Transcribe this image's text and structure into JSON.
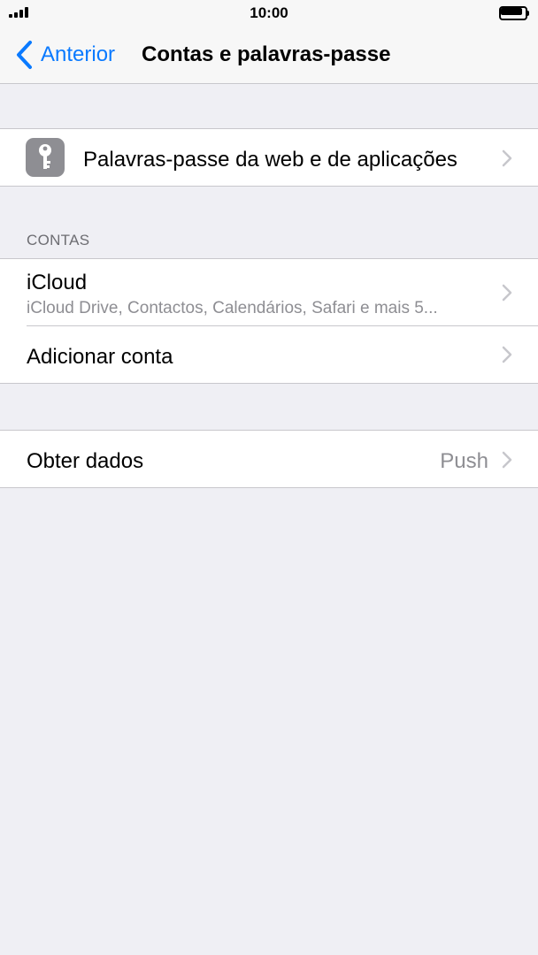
{
  "status_bar": {
    "time": "10:00"
  },
  "nav": {
    "back_label": "Anterior",
    "title": "Contas e palavras-passe"
  },
  "passwords_group": {
    "label": "Palavras-passe da web e de aplicações",
    "icon": "key-icon"
  },
  "accounts_section": {
    "header": "CONTAS",
    "items": [
      {
        "label": "iCloud",
        "sublabel": "iCloud Drive, Contactos, Calendários, Safari e mais 5..."
      },
      {
        "label": "Adicionar conta"
      }
    ]
  },
  "fetch_group": {
    "label": "Obter dados",
    "value": "Push"
  },
  "colors": {
    "accent": "#0a7aff",
    "background": "#efeff4",
    "secondary_text": "#8e8e93",
    "icon_gray": "#8e8e93"
  }
}
